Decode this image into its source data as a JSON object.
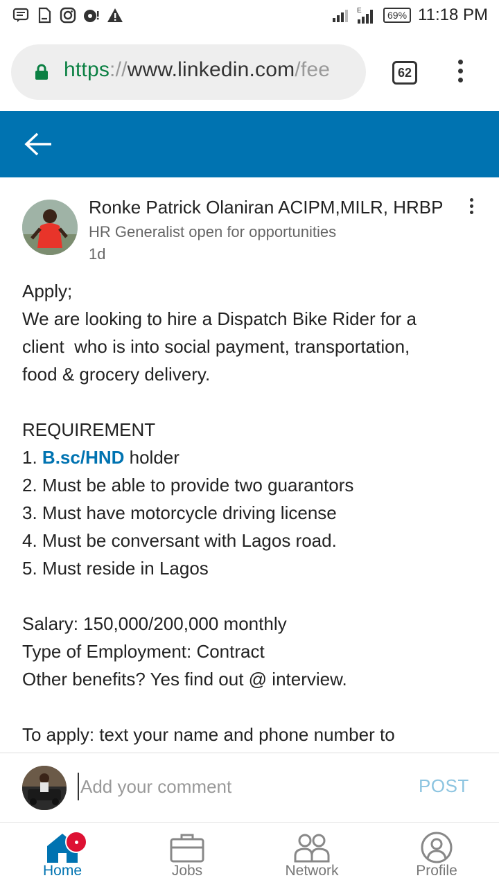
{
  "status_bar": {
    "battery": "69%",
    "time": "11:18 PM",
    "icons": [
      "message-icon",
      "sim-icon",
      "instagram-icon",
      "music-icon",
      "warning-icon",
      "signal-icon",
      "battery-icon"
    ]
  },
  "browser": {
    "url_scheme": "https",
    "url_sep": "://",
    "url_host": "www.linkedin.com",
    "url_path": "/fee",
    "tab_count": "62"
  },
  "header": {
    "back_icon": "arrow-left-icon",
    "color": "#0073b1"
  },
  "post": {
    "author_name": "Ronke Patrick Olaniran ACIPM,MILR, HRBP",
    "author_title": "HR Generalist open for opportunities",
    "time": "1d",
    "body": {
      "l1": "Apply;",
      "l2": "We are looking to hire a Dispatch Bike Rider for a",
      "l3": "client  who is into social payment, transportation,",
      "l4": "food & grocery delivery.",
      "l5": "REQUIREMENT",
      "l6_prefix": "1. ",
      "l6_link": "B.sc/HND",
      "l6_suffix": " holder",
      "l7": "2. Must be able to provide two guarantors",
      "l8": "3. Must have motorcycle driving license",
      "l9": "4. Must be conversant with Lagos road.",
      "l10": "5. Must reside in Lagos",
      "l11": "Salary: 150,000/200,000 monthly",
      "l12": "Type of Employment: Contract",
      "l13": "Other benefits? Yes find out @ interview.",
      "l14": "To apply: text your name and phone number to"
    }
  },
  "comment": {
    "placeholder": "Add your comment",
    "post_label": "POST"
  },
  "nav": {
    "home": "Home",
    "jobs": "Jobs",
    "network": "Network",
    "profile": "Profile",
    "active": "home",
    "accent": "#0073b1",
    "badge_color": "#dd1133"
  }
}
